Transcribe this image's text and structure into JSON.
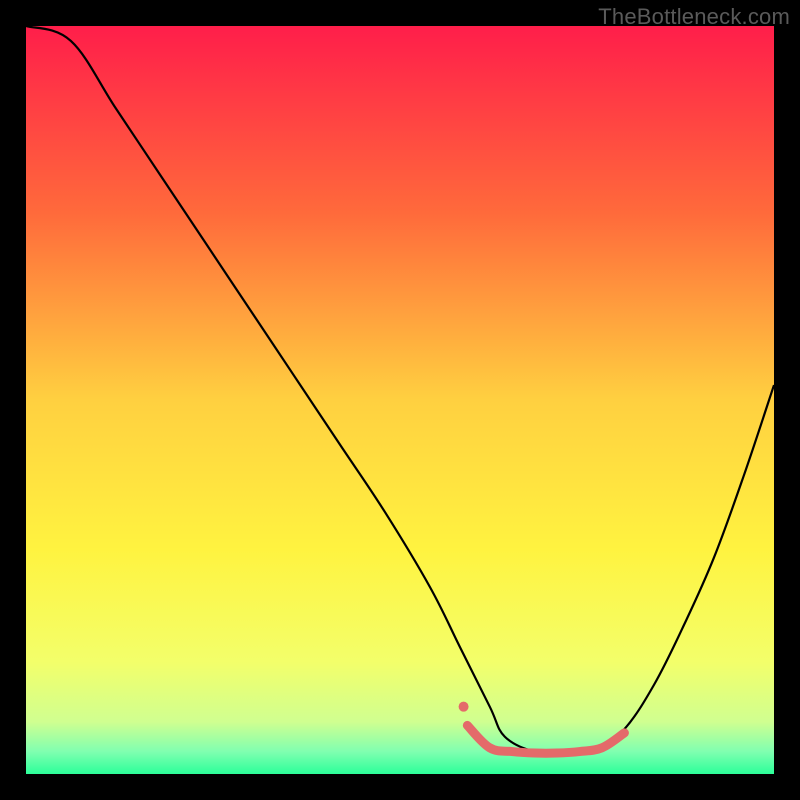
{
  "watermark": "TheBottleneck.com",
  "chart_data": {
    "type": "line",
    "title": "",
    "xlabel": "",
    "ylabel": "",
    "xlim": [
      0,
      100
    ],
    "ylim": [
      0,
      100
    ],
    "grid": false,
    "legend": false,
    "background_gradient": {
      "stops": [
        {
          "offset": 0.0,
          "color": "#ff1e4a"
        },
        {
          "offset": 0.25,
          "color": "#ff6a3b"
        },
        {
          "offset": 0.5,
          "color": "#ffd040"
        },
        {
          "offset": 0.7,
          "color": "#fff340"
        },
        {
          "offset": 0.85,
          "color": "#f3ff6a"
        },
        {
          "offset": 0.93,
          "color": "#d0ff90"
        },
        {
          "offset": 0.97,
          "color": "#80ffb0"
        },
        {
          "offset": 1.0,
          "color": "#2cff9a"
        }
      ]
    },
    "series": [
      {
        "name": "bottleneck-curve",
        "color": "#000000",
        "stroke_width": 2.2,
        "x": [
          0,
          6,
          12,
          18,
          24,
          30,
          36,
          42,
          48,
          54,
          58,
          62,
          64,
          68,
          72,
          76,
          80,
          84,
          88,
          92,
          96,
          100
        ],
        "y": [
          100,
          98,
          89,
          80,
          71,
          62,
          53,
          44,
          35,
          25,
          17,
          9,
          5,
          3,
          3,
          3,
          6,
          12,
          20,
          29,
          40,
          52
        ]
      },
      {
        "name": "highlight-band",
        "color": "#e46a6a",
        "stroke_width": 9,
        "linecap": "round",
        "x": [
          59,
          62,
          65,
          68,
          71,
          74,
          77,
          80
        ],
        "y": [
          6.5,
          3.5,
          3.0,
          2.8,
          2.8,
          3.0,
          3.5,
          5.5
        ]
      },
      {
        "name": "highlight-dot",
        "type": "scatter",
        "color": "#e46a6a",
        "radius": 5,
        "x": [
          58.5
        ],
        "y": [
          9
        ]
      }
    ]
  }
}
